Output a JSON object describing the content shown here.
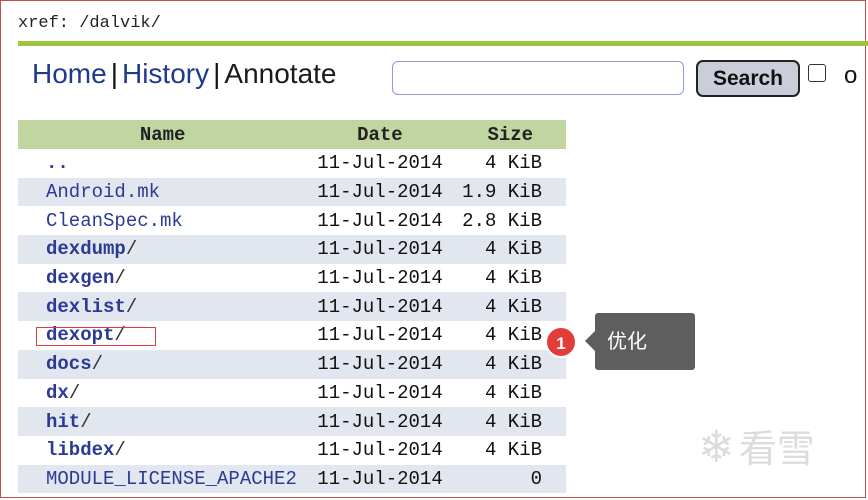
{
  "header": {
    "xref": "xref: /dalvik/"
  },
  "nav": {
    "home": "Home",
    "history": "History",
    "annotate": "Annotate",
    "sep": "|"
  },
  "search": {
    "button": "Search",
    "checkbox_label": "o",
    "value": ""
  },
  "table": {
    "columns": [
      "Name",
      "Date",
      "Size"
    ],
    "rows": [
      {
        "name": "..",
        "dir": true,
        "slash": "",
        "date": "11-Jul-2014",
        "size": "4 KiB"
      },
      {
        "name": "Android.mk",
        "dir": false,
        "slash": "",
        "date": "11-Jul-2014",
        "size": "1.9 KiB"
      },
      {
        "name": "CleanSpec.mk",
        "dir": false,
        "slash": "",
        "date": "11-Jul-2014",
        "size": "2.8 KiB"
      },
      {
        "name": "dexdump",
        "dir": true,
        "slash": "/",
        "date": "11-Jul-2014",
        "size": "4 KiB"
      },
      {
        "name": "dexgen",
        "dir": true,
        "slash": "/",
        "date": "11-Jul-2014",
        "size": "4 KiB"
      },
      {
        "name": "dexlist",
        "dir": true,
        "slash": "/",
        "date": "11-Jul-2014",
        "size": "4 KiB"
      },
      {
        "name": "dexopt",
        "dir": true,
        "slash": "/",
        "date": "11-Jul-2014",
        "size": "4 KiB"
      },
      {
        "name": "docs",
        "dir": true,
        "slash": "/",
        "date": "11-Jul-2014",
        "size": "4 KiB"
      },
      {
        "name": "dx",
        "dir": true,
        "slash": "/",
        "date": "11-Jul-2014",
        "size": "4 KiB"
      },
      {
        "name": "hit",
        "dir": true,
        "slash": "/",
        "date": "11-Jul-2014",
        "size": "4 KiB"
      },
      {
        "name": "libdex",
        "dir": true,
        "slash": "/",
        "date": "11-Jul-2014",
        "size": "4 KiB"
      },
      {
        "name": "MODULE_LICENSE_APACHE2",
        "dir": false,
        "slash": "",
        "date": "11-Jul-2014",
        "size": "0"
      }
    ]
  },
  "annotation": {
    "badge": "1",
    "tooltip": "优化"
  },
  "watermark": {
    "icon": "snowflake-icon",
    "text": "看雪"
  },
  "colors": {
    "accent_green": "#9bc53d",
    "header_bg": "#c1d5a0",
    "link": "#2b3a93",
    "badge": "#e23d38"
  }
}
